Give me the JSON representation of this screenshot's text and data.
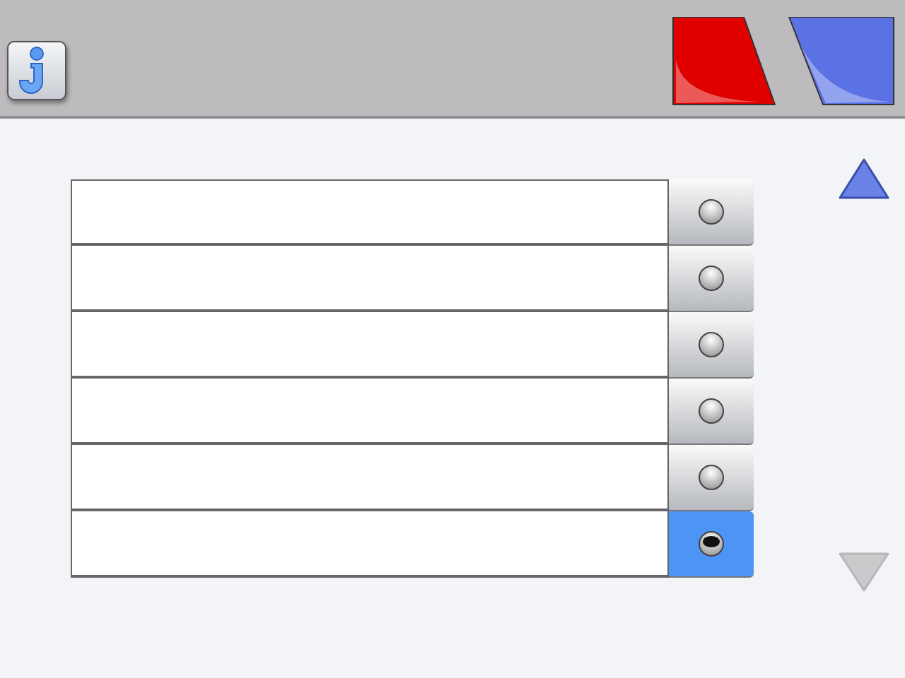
{
  "header": {
    "info_button": {
      "kind": "info"
    },
    "action_buttons": [
      {
        "color": "#e00000"
      },
      {
        "color": "#5a72e4"
      }
    ]
  },
  "list": {
    "rows": [
      {
        "selected": false
      },
      {
        "selected": false
      },
      {
        "selected": false
      },
      {
        "selected": false
      },
      {
        "selected": false
      },
      {
        "selected": true
      }
    ]
  },
  "scroll": {
    "up": {
      "disabled": false
    },
    "down": {
      "disabled": true
    }
  }
}
